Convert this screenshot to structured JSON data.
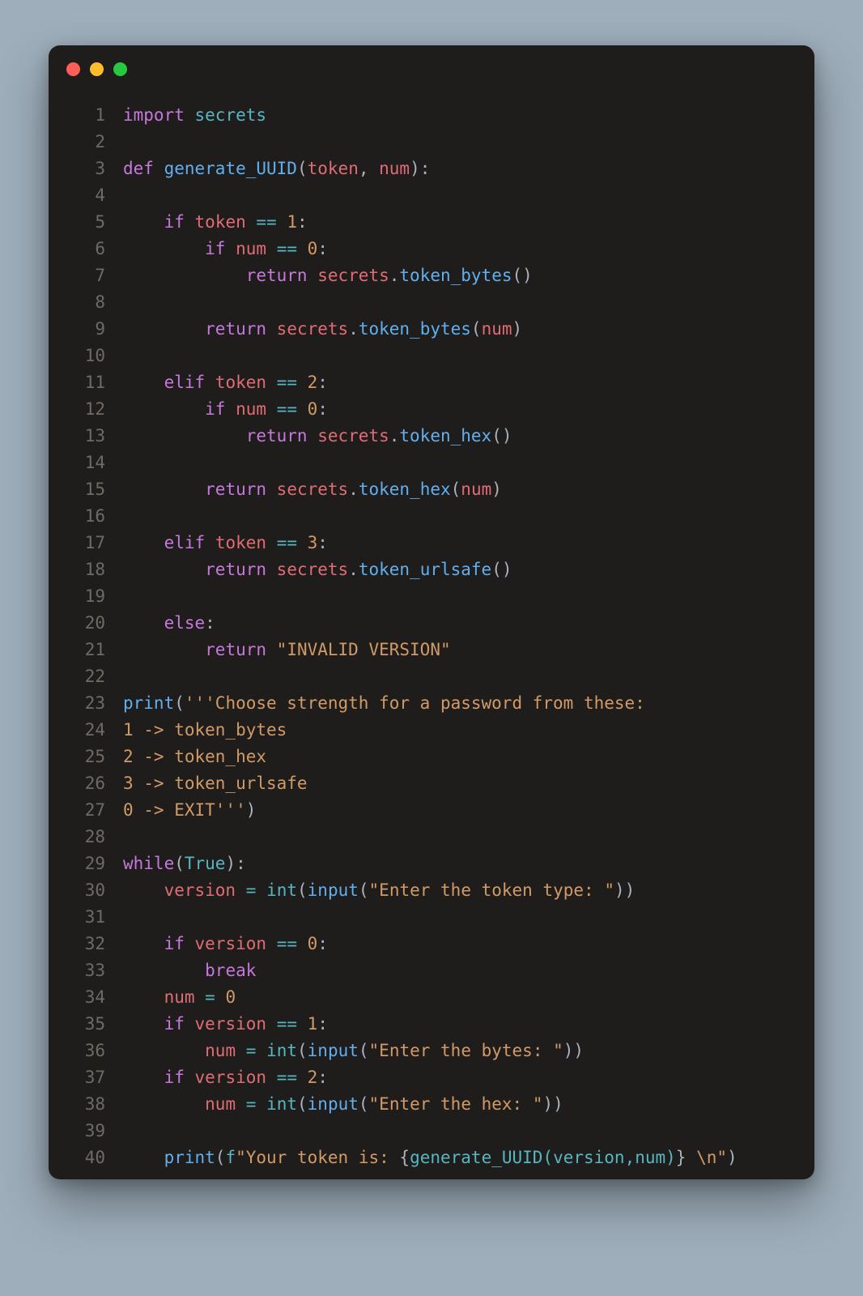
{
  "window": {
    "buttons": [
      "close",
      "minimize",
      "zoom"
    ]
  },
  "code": {
    "lines": [
      [
        {
          "c": "kw",
          "t": "import"
        },
        {
          "c": "plain",
          "t": " "
        },
        {
          "c": "mod",
          "t": "secrets"
        }
      ],
      [],
      [
        {
          "c": "kw",
          "t": "def"
        },
        {
          "c": "plain",
          "t": " "
        },
        {
          "c": "fn",
          "t": "generate_UUID"
        },
        {
          "c": "pun",
          "t": "("
        },
        {
          "c": "var",
          "t": "token"
        },
        {
          "c": "pun",
          "t": ", "
        },
        {
          "c": "var",
          "t": "num"
        },
        {
          "c": "pun",
          "t": "):"
        }
      ],
      [],
      [
        {
          "c": "plain",
          "t": "    "
        },
        {
          "c": "kw",
          "t": "if"
        },
        {
          "c": "plain",
          "t": " "
        },
        {
          "c": "var",
          "t": "token"
        },
        {
          "c": "plain",
          "t": " "
        },
        {
          "c": "op",
          "t": "=="
        },
        {
          "c": "plain",
          "t": " "
        },
        {
          "c": "num",
          "t": "1"
        },
        {
          "c": "pun",
          "t": ":"
        }
      ],
      [
        {
          "c": "plain",
          "t": "        "
        },
        {
          "c": "kw",
          "t": "if"
        },
        {
          "c": "plain",
          "t": " "
        },
        {
          "c": "var",
          "t": "num"
        },
        {
          "c": "plain",
          "t": " "
        },
        {
          "c": "op",
          "t": "=="
        },
        {
          "c": "plain",
          "t": " "
        },
        {
          "c": "num",
          "t": "0"
        },
        {
          "c": "pun",
          "t": ":"
        }
      ],
      [
        {
          "c": "plain",
          "t": "            "
        },
        {
          "c": "kw",
          "t": "return"
        },
        {
          "c": "plain",
          "t": " "
        },
        {
          "c": "var",
          "t": "secrets"
        },
        {
          "c": "pun",
          "t": "."
        },
        {
          "c": "fn",
          "t": "token_bytes"
        },
        {
          "c": "pun",
          "t": "()"
        }
      ],
      [],
      [
        {
          "c": "plain",
          "t": "        "
        },
        {
          "c": "kw",
          "t": "return"
        },
        {
          "c": "plain",
          "t": " "
        },
        {
          "c": "var",
          "t": "secrets"
        },
        {
          "c": "pun",
          "t": "."
        },
        {
          "c": "fn",
          "t": "token_bytes"
        },
        {
          "c": "pun",
          "t": "("
        },
        {
          "c": "var",
          "t": "num"
        },
        {
          "c": "pun",
          "t": ")"
        }
      ],
      [],
      [
        {
          "c": "plain",
          "t": "    "
        },
        {
          "c": "kw",
          "t": "elif"
        },
        {
          "c": "plain",
          "t": " "
        },
        {
          "c": "var",
          "t": "token"
        },
        {
          "c": "plain",
          "t": " "
        },
        {
          "c": "op",
          "t": "=="
        },
        {
          "c": "plain",
          "t": " "
        },
        {
          "c": "num",
          "t": "2"
        },
        {
          "c": "pun",
          "t": ":"
        }
      ],
      [
        {
          "c": "plain",
          "t": "        "
        },
        {
          "c": "kw",
          "t": "if"
        },
        {
          "c": "plain",
          "t": " "
        },
        {
          "c": "var",
          "t": "num"
        },
        {
          "c": "plain",
          "t": " "
        },
        {
          "c": "op",
          "t": "=="
        },
        {
          "c": "plain",
          "t": " "
        },
        {
          "c": "num",
          "t": "0"
        },
        {
          "c": "pun",
          "t": ":"
        }
      ],
      [
        {
          "c": "plain",
          "t": "            "
        },
        {
          "c": "kw",
          "t": "return"
        },
        {
          "c": "plain",
          "t": " "
        },
        {
          "c": "var",
          "t": "secrets"
        },
        {
          "c": "pun",
          "t": "."
        },
        {
          "c": "fn",
          "t": "token_hex"
        },
        {
          "c": "pun",
          "t": "()"
        }
      ],
      [],
      [
        {
          "c": "plain",
          "t": "        "
        },
        {
          "c": "kw",
          "t": "return"
        },
        {
          "c": "plain",
          "t": " "
        },
        {
          "c": "var",
          "t": "secrets"
        },
        {
          "c": "pun",
          "t": "."
        },
        {
          "c": "fn",
          "t": "token_hex"
        },
        {
          "c": "pun",
          "t": "("
        },
        {
          "c": "var",
          "t": "num"
        },
        {
          "c": "pun",
          "t": ")"
        }
      ],
      [],
      [
        {
          "c": "plain",
          "t": "    "
        },
        {
          "c": "kw",
          "t": "elif"
        },
        {
          "c": "plain",
          "t": " "
        },
        {
          "c": "var",
          "t": "token"
        },
        {
          "c": "plain",
          "t": " "
        },
        {
          "c": "op",
          "t": "=="
        },
        {
          "c": "plain",
          "t": " "
        },
        {
          "c": "num",
          "t": "3"
        },
        {
          "c": "pun",
          "t": ":"
        }
      ],
      [
        {
          "c": "plain",
          "t": "        "
        },
        {
          "c": "kw",
          "t": "return"
        },
        {
          "c": "plain",
          "t": " "
        },
        {
          "c": "var",
          "t": "secrets"
        },
        {
          "c": "pun",
          "t": "."
        },
        {
          "c": "fn",
          "t": "token_urlsafe"
        },
        {
          "c": "pun",
          "t": "()"
        }
      ],
      [],
      [
        {
          "c": "plain",
          "t": "    "
        },
        {
          "c": "kw",
          "t": "else"
        },
        {
          "c": "pun",
          "t": ":"
        }
      ],
      [
        {
          "c": "plain",
          "t": "        "
        },
        {
          "c": "kw",
          "t": "return"
        },
        {
          "c": "plain",
          "t": " "
        },
        {
          "c": "str",
          "t": "\"INVALID VERSION\""
        }
      ],
      [],
      [
        {
          "c": "fn",
          "t": "print"
        },
        {
          "c": "pun",
          "t": "("
        },
        {
          "c": "str",
          "t": "'''Choose strength for a password from these:"
        }
      ],
      [
        {
          "c": "str",
          "t": "1 -> token_bytes"
        }
      ],
      [
        {
          "c": "str",
          "t": "2 -> token_hex"
        }
      ],
      [
        {
          "c": "str",
          "t": "3 -> token_urlsafe"
        }
      ],
      [
        {
          "c": "str",
          "t": "0 -> EXIT'''"
        },
        {
          "c": "pun",
          "t": ")"
        }
      ],
      [],
      [
        {
          "c": "kw",
          "t": "while"
        },
        {
          "c": "pun",
          "t": "("
        },
        {
          "c": "mod",
          "t": "True"
        },
        {
          "c": "pun",
          "t": "):"
        }
      ],
      [
        {
          "c": "plain",
          "t": "    "
        },
        {
          "c": "var",
          "t": "version"
        },
        {
          "c": "plain",
          "t": " "
        },
        {
          "c": "op",
          "t": "="
        },
        {
          "c": "plain",
          "t": " "
        },
        {
          "c": "mod",
          "t": "int"
        },
        {
          "c": "pun",
          "t": "("
        },
        {
          "c": "fn",
          "t": "input"
        },
        {
          "c": "pun",
          "t": "("
        },
        {
          "c": "str",
          "t": "\"Enter the token type: \""
        },
        {
          "c": "pun",
          "t": "))"
        }
      ],
      [],
      [
        {
          "c": "plain",
          "t": "    "
        },
        {
          "c": "kw",
          "t": "if"
        },
        {
          "c": "plain",
          "t": " "
        },
        {
          "c": "var",
          "t": "version"
        },
        {
          "c": "plain",
          "t": " "
        },
        {
          "c": "op",
          "t": "=="
        },
        {
          "c": "plain",
          "t": " "
        },
        {
          "c": "num",
          "t": "0"
        },
        {
          "c": "pun",
          "t": ":"
        }
      ],
      [
        {
          "c": "plain",
          "t": "        "
        },
        {
          "c": "kw",
          "t": "break"
        }
      ],
      [
        {
          "c": "plain",
          "t": "    "
        },
        {
          "c": "var",
          "t": "num"
        },
        {
          "c": "plain",
          "t": " "
        },
        {
          "c": "op",
          "t": "="
        },
        {
          "c": "plain",
          "t": " "
        },
        {
          "c": "num",
          "t": "0"
        }
      ],
      [
        {
          "c": "plain",
          "t": "    "
        },
        {
          "c": "kw",
          "t": "if"
        },
        {
          "c": "plain",
          "t": " "
        },
        {
          "c": "var",
          "t": "version"
        },
        {
          "c": "plain",
          "t": " "
        },
        {
          "c": "op",
          "t": "=="
        },
        {
          "c": "plain",
          "t": " "
        },
        {
          "c": "num",
          "t": "1"
        },
        {
          "c": "pun",
          "t": ":"
        }
      ],
      [
        {
          "c": "plain",
          "t": "        "
        },
        {
          "c": "var",
          "t": "num"
        },
        {
          "c": "plain",
          "t": " "
        },
        {
          "c": "op",
          "t": "="
        },
        {
          "c": "plain",
          "t": " "
        },
        {
          "c": "mod",
          "t": "int"
        },
        {
          "c": "pun",
          "t": "("
        },
        {
          "c": "fn",
          "t": "input"
        },
        {
          "c": "pun",
          "t": "("
        },
        {
          "c": "str",
          "t": "\"Enter the bytes: \""
        },
        {
          "c": "pun",
          "t": "))"
        }
      ],
      [
        {
          "c": "plain",
          "t": "    "
        },
        {
          "c": "kw",
          "t": "if"
        },
        {
          "c": "plain",
          "t": " "
        },
        {
          "c": "var",
          "t": "version"
        },
        {
          "c": "plain",
          "t": " "
        },
        {
          "c": "op",
          "t": "=="
        },
        {
          "c": "plain",
          "t": " "
        },
        {
          "c": "num",
          "t": "2"
        },
        {
          "c": "pun",
          "t": ":"
        }
      ],
      [
        {
          "c": "plain",
          "t": "        "
        },
        {
          "c": "var",
          "t": "num"
        },
        {
          "c": "plain",
          "t": " "
        },
        {
          "c": "op",
          "t": "="
        },
        {
          "c": "plain",
          "t": " "
        },
        {
          "c": "mod",
          "t": "int"
        },
        {
          "c": "pun",
          "t": "("
        },
        {
          "c": "fn",
          "t": "input"
        },
        {
          "c": "pun",
          "t": "("
        },
        {
          "c": "str",
          "t": "\"Enter the hex: \""
        },
        {
          "c": "pun",
          "t": "))"
        }
      ],
      [],
      [
        {
          "c": "plain",
          "t": "    "
        },
        {
          "c": "fn",
          "t": "print"
        },
        {
          "c": "pun",
          "t": "("
        },
        {
          "c": "mod",
          "t": "f"
        },
        {
          "c": "str",
          "t": "\"Your token is: "
        },
        {
          "c": "pun",
          "t": "{"
        },
        {
          "c": "mod",
          "t": "generate_UUID(version,num)"
        },
        {
          "c": "pun",
          "t": "}"
        },
        {
          "c": "str",
          "t": " \\n\""
        },
        {
          "c": "pun",
          "t": ")"
        }
      ]
    ]
  }
}
